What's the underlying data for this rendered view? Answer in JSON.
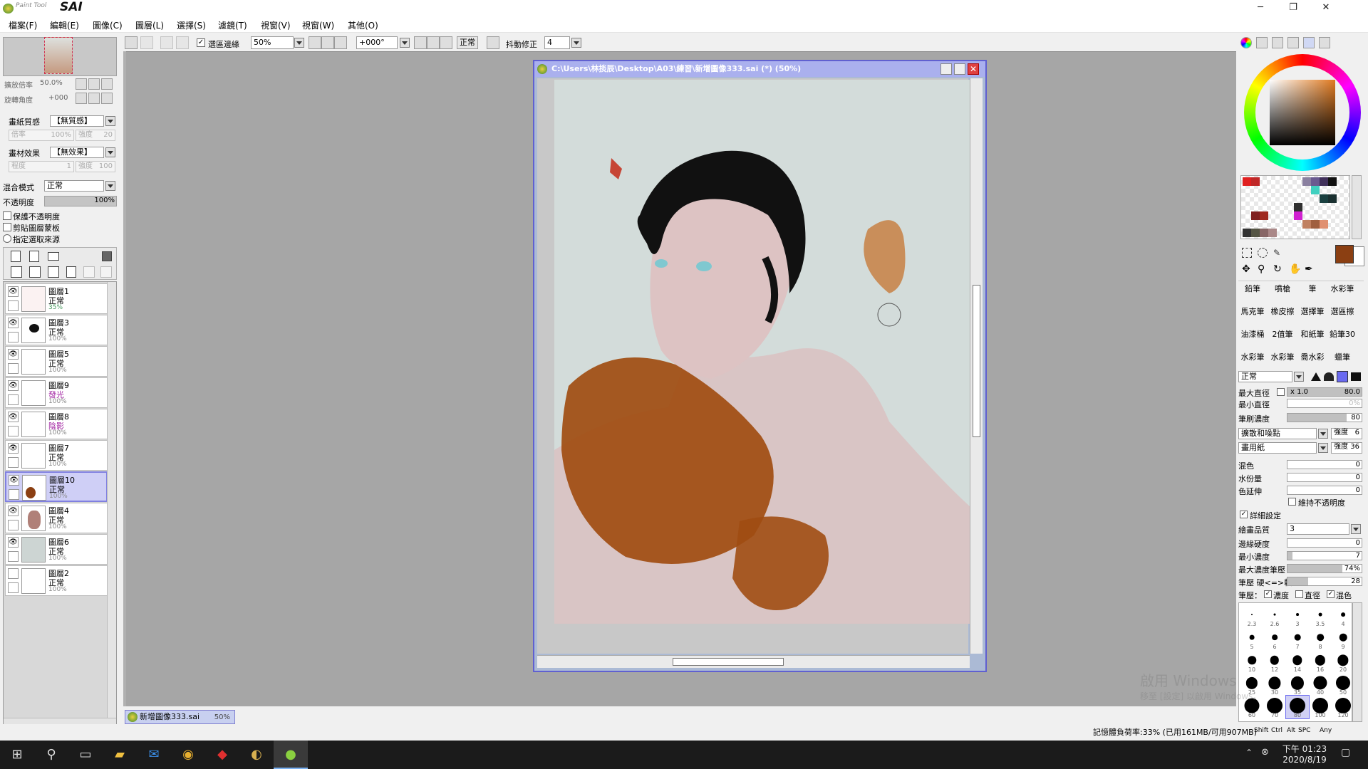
{
  "app": {
    "name_small": "Paint Tool",
    "name_big": "SAI"
  },
  "window_controls": {
    "minimize": "─",
    "restore": "❐",
    "close": "✕"
  },
  "menu": [
    "檔案(F)",
    "編輯(E)",
    "圖像(C)",
    "圖層(L)",
    "選擇(S)",
    "濾鏡(T)",
    "視窗(V)",
    "視窗(W)",
    "其他(O)"
  ],
  "toolbar": {
    "selection_edge_label": "選區邊緣",
    "zoom_value": "50%",
    "rotation_value": "+000°",
    "blend_label": "正常",
    "stabilizer_label": "抖動修正",
    "stabilizer_value": "4"
  },
  "navigator": {
    "zoom_label": "擴放倍率",
    "zoom_value": "50.0%",
    "rotate_label": "旋轉角度",
    "rotate_value": "+000"
  },
  "paper": {
    "texture_label": "畫紙質感",
    "texture_value": "【無質感】",
    "scale_label": "倍率",
    "scale_value": "100%",
    "strength_label": "強度",
    "strength_value": "20",
    "effect_label": "畫材效果",
    "effect_value": "【無效果】",
    "degree_label": "程度",
    "degree_value": "1",
    "effect_strength_label": "強度",
    "effect_strength_value": "100"
  },
  "layer_props": {
    "blend_label": "混合模式",
    "blend_value": "正常",
    "opacity_label": "不透明度",
    "opacity_value": "100%",
    "preserve_opacity": "保護不透明度",
    "clip_group": "剪貼圖層蒙板",
    "selection_source": "指定選取來源"
  },
  "layers": [
    {
      "name": "圖層1",
      "mode": "正常",
      "opacity": "35%",
      "mode_color": "#000"
    },
    {
      "name": "圖層3",
      "mode": "正常",
      "opacity": "100%",
      "mode_color": "#000"
    },
    {
      "name": "圖層5",
      "mode": "正常",
      "opacity": "100%",
      "mode_color": "#000"
    },
    {
      "name": "圖層9",
      "mode": "發光",
      "opacity": "100%",
      "mode_color": "#a020a0"
    },
    {
      "name": "圖層8",
      "mode": "陰影",
      "opacity": "100%",
      "mode_color": "#a020a0"
    },
    {
      "name": "圖層7",
      "mode": "正常",
      "opacity": "100%",
      "mode_color": "#000"
    },
    {
      "name": "圖層10",
      "mode": "正常",
      "opacity": "100%",
      "mode_color": "#000"
    },
    {
      "name": "圖層4",
      "mode": "正常",
      "opacity": "100%",
      "mode_color": "#000"
    },
    {
      "name": "圖層6",
      "mode": "正常",
      "opacity": "100%",
      "mode_color": "#000"
    },
    {
      "name": "圖層2",
      "mode": "正常",
      "opacity": "100%",
      "mode_color": "#000"
    }
  ],
  "document": {
    "title": "C:\\Users\\林掞辰\\Desktop\\A03\\練習\\新增圖像333.sai (*) (50%)",
    "tab_name": "新增圖像333.sai",
    "tab_zoom": "50%"
  },
  "colors": {
    "primary": "#8b3f12",
    "secondary": "#ffffff",
    "accent": "#6060d0"
  },
  "brush_tools": [
    [
      "鉛筆",
      "噴槍",
      "筆",
      "水彩筆"
    ],
    [
      "馬克筆",
      "橡皮擦",
      "選擇筆",
      "選區擦"
    ],
    [
      "油漆桶",
      "2值筆",
      "和紙筆",
      "鉛筆30"
    ],
    [
      "水彩筆",
      "水彩筆",
      "喬水彩",
      "蠟筆"
    ]
  ],
  "brush_settings": {
    "mode_value": "正常",
    "max_size_label": "最大直徑",
    "max_size_mult": "x 1.0",
    "max_size_value": "80.0",
    "min_size_label": "最小直徑",
    "min_size_value": "0%",
    "density_label": "筆刷濃度",
    "density_value": "80",
    "shape_value": "擴散和噪點",
    "shape_strength_label": "強度",
    "shape_strength_value": "6",
    "texture_value": "畫用紙",
    "texture_strength_label": "強度",
    "texture_strength_value": "36",
    "blend_label": "混色",
    "blend_value": "0",
    "water_label": "水份量",
    "water_value": "0",
    "persistence_label": "色延伸",
    "persistence_value": "0",
    "keep_opacity_label": "維持不透明度",
    "detail_label": "詳細設定",
    "quality_label": "繪畫品質",
    "quality_value": "3",
    "edge_label": "邊緣硬度",
    "edge_value": "0",
    "min_density_label": "最小濃度",
    "min_density_value": "7",
    "max_pressure_label": "最大濃度筆壓",
    "max_pressure_value": "74%",
    "hardness_label": "筆壓 硬<=>軟",
    "hardness_value": "28",
    "pressure_label": "筆壓：",
    "pressure_density": "濃度",
    "pressure_size": "直徑",
    "pressure_blend": "混色"
  },
  "brush_sizes": [
    "2.3",
    "2.6",
    "3",
    "3.5",
    "4",
    "5",
    "6",
    "7",
    "8",
    "9",
    "10",
    "12",
    "14",
    "16",
    "20",
    "25",
    "30",
    "35",
    "40",
    "50",
    "60",
    "70",
    "80",
    "100",
    "120"
  ],
  "status": {
    "memory": "記憶體負荷率:33% (已用161MB/可用907MB)",
    "keys": [
      "Shift",
      "Ctrl",
      "Alt",
      "SPC",
      "Any"
    ]
  },
  "watermark": {
    "line1": "啟用 Windows",
    "line2": "移至 [設定] 以啟用 Windows。"
  },
  "taskbar": {
    "time": "下午 01:23",
    "date": "2020/8/19"
  }
}
